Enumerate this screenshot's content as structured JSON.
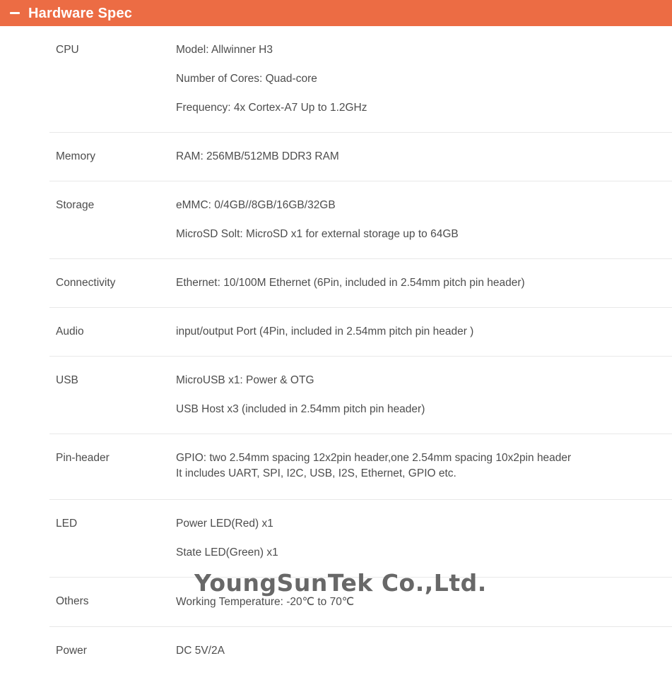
{
  "header": {
    "title": "Hardware Spec",
    "collapse_icon": "minus-icon",
    "background_color": "#ec6c44",
    "text_color": "#ffffff"
  },
  "watermark": {
    "text": "YoungSunTek Co.,Ltd.",
    "color": "#5c5c5c"
  },
  "spec_table": {
    "divider_color": "#e8e8e8",
    "text_color": "#4d4d4d",
    "rows": [
      {
        "label": "CPU",
        "lines": [
          "Model: Allwinner H3",
          "Number of Cores: Quad-core",
          "Frequency: 4x Cortex-A7 Up to 1.2GHz"
        ]
      },
      {
        "label": "Memory",
        "lines": [
          "RAM: 256MB/512MB DDR3 RAM"
        ]
      },
      {
        "label": "Storage",
        "lines": [
          "eMMC: 0/4GB//8GB/16GB/32GB",
          "MicroSD Solt: MicroSD x1 for external storage up to 64GB"
        ]
      },
      {
        "label": "Connectivity",
        "lines": [
          "Ethernet: 10/100M Ethernet (6Pin, included in 2.54mm pitch pin header)"
        ]
      },
      {
        "label": "Audio",
        "lines": [
          "input/output Port (4Pin, included in 2.54mm pitch pin header )"
        ]
      },
      {
        "label": "USB",
        "lines": [
          "MicroUSB x1: Power & OTG",
          "USB Host x3 (included in 2.54mm pitch pin header)"
        ]
      },
      {
        "label": "Pin-header",
        "lines": [
          "GPIO: two 2.54mm spacing 12x2pin header,one 2.54mm spacing 10x2pin header",
          "It includes UART, SPI, I2C, USB, I2S, Ethernet, GPIO etc."
        ]
      },
      {
        "label": "LED",
        "lines": [
          "Power LED(Red) x1",
          "State LED(Green) x1"
        ]
      },
      {
        "label": "Others",
        "lines": [
          "Working Temperature: -20℃ to 70℃"
        ]
      },
      {
        "label": "Power",
        "lines": [
          "DC 5V/2A"
        ]
      }
    ]
  }
}
